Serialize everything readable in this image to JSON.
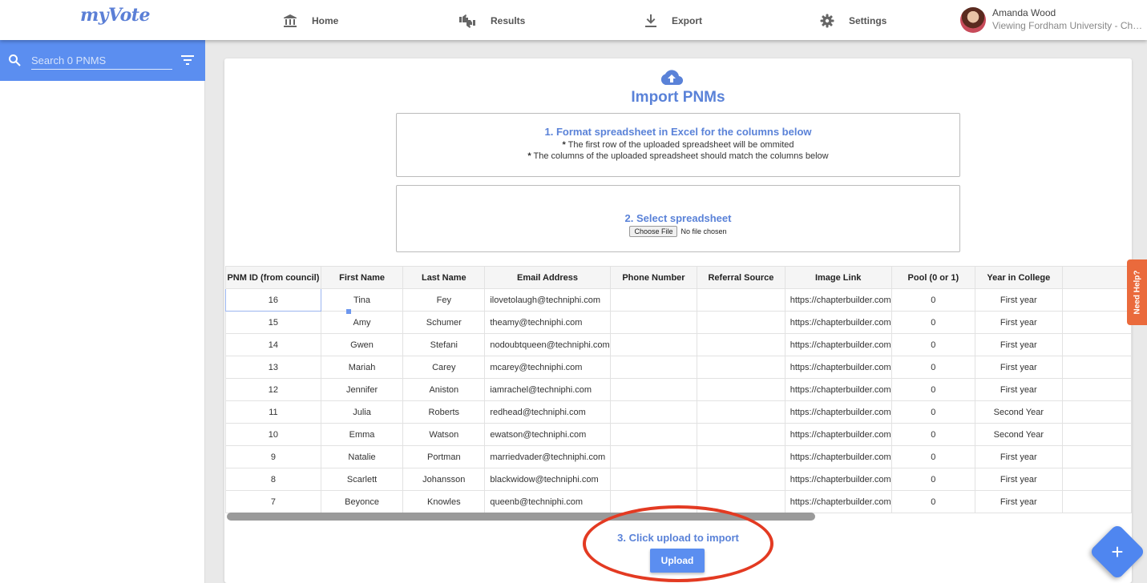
{
  "app": {
    "logo_text": "myVote"
  },
  "nav": {
    "home": "Home",
    "results": "Results",
    "export": "Export",
    "settings": "Settings"
  },
  "user": {
    "name": "Amanda Wood",
    "subtitle": "Viewing Fordham University - Chapter"
  },
  "sidebar": {
    "search_placeholder": "Search 0 PNMS"
  },
  "import": {
    "title": "Import PNMs",
    "step1_title": "1. Format spreadsheet in Excel for the columns below",
    "step1_note1_bullet": "*",
    "step1_note1": "The first row of the uploaded spreadsheet will be ommited",
    "step1_note2_bullet": "*",
    "step1_note2": "The columns of the uploaded spreadsheet should match the columns below",
    "step2_title": "2. Select spreadsheet",
    "choose_file": "Choose File",
    "no_file": "No file chosen",
    "step3_title": "3. Click upload to import",
    "upload_label": "Upload"
  },
  "table": {
    "headers": [
      "PNM ID (from council)",
      "First Name",
      "Last Name",
      "Email Address",
      "Phone Number",
      "Referral Source",
      "Image Link",
      "Pool (0 or 1)",
      "Year in College",
      ""
    ],
    "rows": [
      [
        "16",
        "Tina",
        "Fey",
        "ilovetolaugh@techniphi.com",
        "",
        "",
        "https://chapterbuilder.com",
        "0",
        "First year",
        ""
      ],
      [
        "15",
        "Amy",
        "Schumer",
        "theamy@techniphi.com",
        "",
        "",
        "https://chapterbuilder.com",
        "0",
        "First year",
        ""
      ],
      [
        "14",
        "Gwen",
        "Stefani",
        "nodoubtqueen@techniphi.com",
        "",
        "",
        "https://chapterbuilder.com",
        "0",
        "First year",
        ""
      ],
      [
        "13",
        "Mariah",
        "Carey",
        "mcarey@techniphi.com",
        "",
        "",
        "https://chapterbuilder.com",
        "0",
        "First year",
        ""
      ],
      [
        "12",
        "Jennifer",
        "Aniston",
        "iamrachel@techniphi.com",
        "",
        "",
        "https://chapterbuilder.com",
        "0",
        "First year",
        ""
      ],
      [
        "11",
        "Julia",
        "Roberts",
        "redhead@techniphi.com",
        "",
        "",
        "https://chapterbuilder.com",
        "0",
        "Second Year",
        ""
      ],
      [
        "10",
        "Emma",
        "Watson",
        "ewatson@techniphi.com",
        "",
        "",
        "https://chapterbuilder.com",
        "0",
        "Second Year",
        ""
      ],
      [
        "9",
        "Natalie",
        "Portman",
        "marriedvader@techniphi.com",
        "",
        "",
        "https://chapterbuilder.com",
        "0",
        "First year",
        ""
      ],
      [
        "8",
        "Scarlett",
        "Johansson",
        "blackwidow@techniphi.com",
        "",
        "",
        "https://chapterbuilder.com",
        "0",
        "First year",
        ""
      ],
      [
        "7",
        "Beyonce",
        "Knowles",
        "queenb@techniphi.com",
        "",
        "",
        "https://chapterbuilder.com",
        "0",
        "First year",
        ""
      ]
    ]
  },
  "help": {
    "label": "Need Help?"
  },
  "fab": {
    "label": "+"
  },
  "colors": {
    "accent": "#5b8ef0",
    "title": "#5a82d8",
    "help": "#ea6a3c",
    "annotation": "#e33a22"
  },
  "icons": {
    "home": "bank-icon",
    "results": "thumbs-icon",
    "export": "download-icon",
    "settings": "gear-icon",
    "search": "search-icon",
    "filter": "filter-icon",
    "upload": "cloud-upload-icon"
  }
}
